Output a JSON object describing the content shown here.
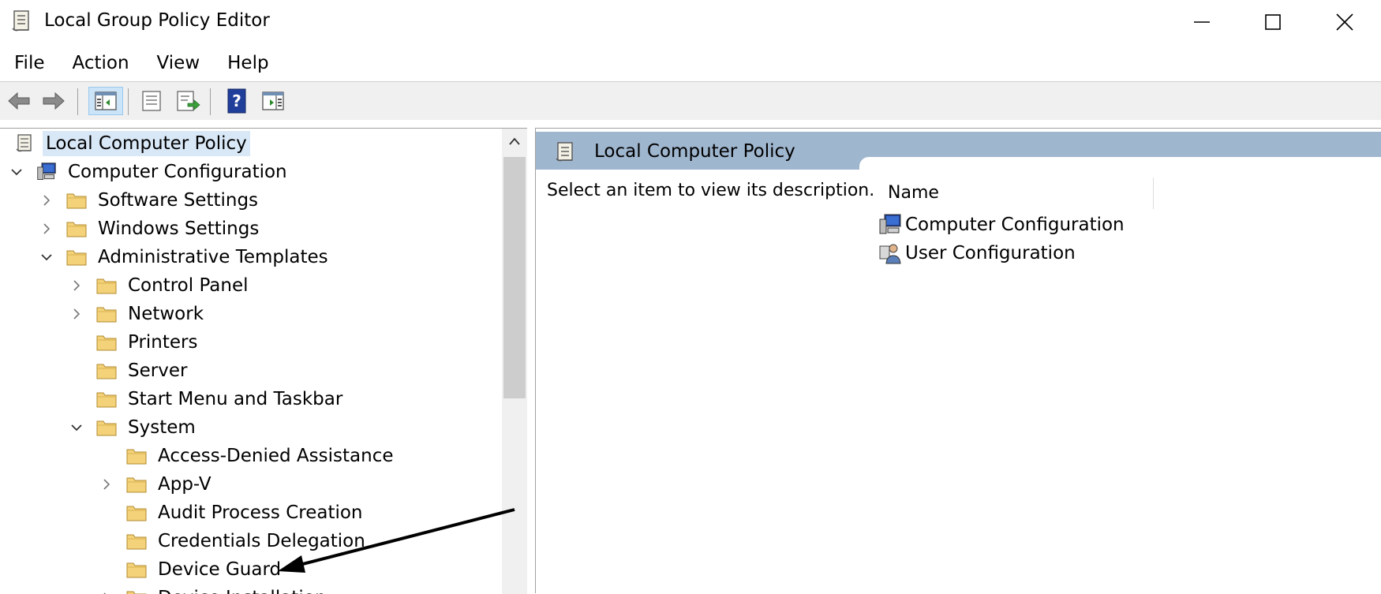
{
  "window": {
    "title": "Local Group Policy Editor",
    "minimize_icon": "minimize-icon",
    "maximize_icon": "maximize-icon",
    "close_icon": "close-icon"
  },
  "menu": [
    {
      "label": "File"
    },
    {
      "label": "Action"
    },
    {
      "label": "View"
    },
    {
      "label": "Help"
    }
  ],
  "toolbar": {
    "buttons": [
      "back-icon",
      "forward-icon",
      "show-hide-console-tree-icon",
      "properties-icon",
      "export-list-icon",
      "help-icon",
      "show-hide-action-pane-icon"
    ]
  },
  "tree": {
    "items": [
      {
        "label": "Local Computer Policy",
        "level": 0,
        "expand": "none",
        "icon": "policy-scroll-icon",
        "selected": true
      },
      {
        "label": "Computer Configuration",
        "level": 0,
        "expand": "open",
        "icon": "computer-icon"
      },
      {
        "label": "Software Settings",
        "level": 1,
        "expand": "closed",
        "icon": "folder-icon"
      },
      {
        "label": "Windows Settings",
        "level": 1,
        "expand": "closed",
        "icon": "folder-icon"
      },
      {
        "label": "Administrative Templates",
        "level": 1,
        "expand": "open",
        "icon": "folder-icon"
      },
      {
        "label": "Control Panel",
        "level": 2,
        "expand": "closed",
        "icon": "folder-icon"
      },
      {
        "label": "Network",
        "level": 2,
        "expand": "closed",
        "icon": "folder-icon"
      },
      {
        "label": "Printers",
        "level": 2,
        "expand": "none",
        "icon": "folder-icon"
      },
      {
        "label": "Server",
        "level": 2,
        "expand": "none",
        "icon": "folder-icon"
      },
      {
        "label": "Start Menu and Taskbar",
        "level": 2,
        "expand": "none",
        "icon": "folder-icon"
      },
      {
        "label": "System",
        "level": 2,
        "expand": "open",
        "icon": "folder-icon"
      },
      {
        "label": "Access-Denied Assistance",
        "level": 3,
        "expand": "none",
        "icon": "folder-icon"
      },
      {
        "label": "App-V",
        "level": 3,
        "expand": "closed",
        "icon": "folder-icon"
      },
      {
        "label": "Audit Process Creation",
        "level": 3,
        "expand": "none",
        "icon": "folder-icon"
      },
      {
        "label": "Credentials Delegation",
        "level": 3,
        "expand": "none",
        "icon": "folder-icon"
      },
      {
        "label": "Device Guard",
        "level": 3,
        "expand": "none",
        "icon": "folder-icon"
      },
      {
        "label": "Device Installation",
        "level": 3,
        "expand": "closed",
        "icon": "folder-icon"
      }
    ]
  },
  "right_pane": {
    "header_title": "Local Computer Policy",
    "description": "Select an item to view its description.",
    "column_name": "Name",
    "items": [
      {
        "label": "Computer Configuration",
        "icon": "computer-icon"
      },
      {
        "label": "User Configuration",
        "icon": "user-icon"
      }
    ]
  },
  "colors": {
    "selection": "#d9e8f7",
    "header_band": "#9fb6cf",
    "folder": "#f3d27a"
  }
}
